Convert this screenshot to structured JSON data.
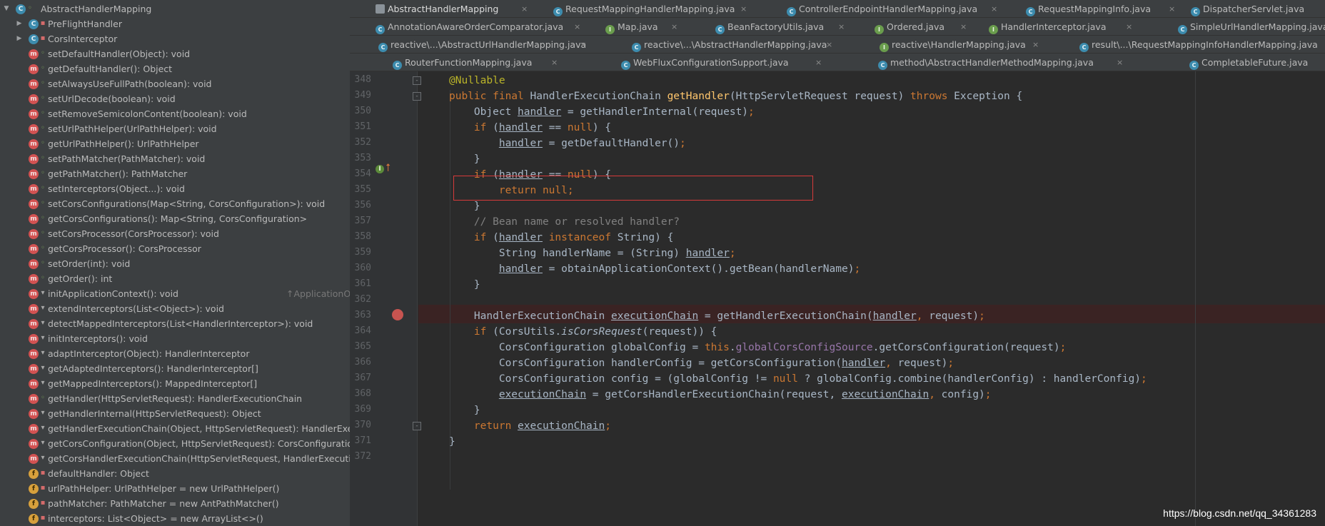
{
  "structure": {
    "root": {
      "label": "AbstractHandlerMapping",
      "icon": "class-icon"
    },
    "items": [
      {
        "label": "PreFlightHandler",
        "icon": "class-icon",
        "kind": "c",
        "access": "closed",
        "expandable": true
      },
      {
        "label": "CorsInterceptor",
        "icon": "class-icon",
        "kind": "c",
        "access": "closed",
        "expandable": true
      },
      {
        "label": "setDefaultHandler(Object): void",
        "kind": "m",
        "access": "open"
      },
      {
        "label": "getDefaultHandler(): Object",
        "kind": "m",
        "access": "open"
      },
      {
        "label": "setAlwaysUseFullPath(boolean): void",
        "kind": "m",
        "access": "open"
      },
      {
        "label": "setUrlDecode(boolean): void",
        "kind": "m",
        "access": "open"
      },
      {
        "label": "setRemoveSemicolonContent(boolean): void",
        "kind": "m",
        "access": "open"
      },
      {
        "label": "setUrlPathHelper(UrlPathHelper): void",
        "kind": "m",
        "access": "open"
      },
      {
        "label": "getUrlPathHelper(): UrlPathHelper",
        "kind": "m",
        "access": "open"
      },
      {
        "label": "setPathMatcher(PathMatcher): void",
        "kind": "m",
        "access": "open"
      },
      {
        "label": "getPathMatcher(): PathMatcher",
        "kind": "m",
        "access": "open"
      },
      {
        "label": "setInterceptors(Object...): void",
        "kind": "m",
        "access": "open"
      },
      {
        "label": "setCorsConfigurations(Map<String, CorsConfiguration>): void",
        "kind": "m",
        "access": "open"
      },
      {
        "label": "getCorsConfigurations(): Map<String, CorsConfiguration>",
        "kind": "m",
        "access": "open"
      },
      {
        "label": "setCorsProcessor(CorsProcessor): void",
        "kind": "m",
        "access": "open"
      },
      {
        "label": "getCorsProcessor(): CorsProcessor",
        "kind": "m",
        "access": "open"
      },
      {
        "label": "setOrder(int): void",
        "kind": "m",
        "access": "open"
      },
      {
        "label": "getOrder(): int",
        "kind": "m",
        "access": "open"
      },
      {
        "label": "initApplicationContext(): void",
        "hint": "↑ApplicationObjectSupport",
        "kind": "m",
        "access": "prot"
      },
      {
        "label": "extendInterceptors(List<Object>): void",
        "kind": "m",
        "access": "prot"
      },
      {
        "label": "detectMappedInterceptors(List<HandlerInterceptor>): void",
        "kind": "m",
        "access": "prot"
      },
      {
        "label": "initInterceptors(): void",
        "kind": "m",
        "access": "prot"
      },
      {
        "label": "adaptInterceptor(Object): HandlerInterceptor",
        "kind": "m",
        "access": "prot"
      },
      {
        "label": "getAdaptedInterceptors(): HandlerInterceptor[]",
        "kind": "m",
        "access": "prot"
      },
      {
        "label": "getMappedInterceptors(): MappedInterceptor[]",
        "kind": "m",
        "access": "prot"
      },
      {
        "label": "getHandler(HttpServletRequest): HandlerExecutionChain",
        "kind": "m",
        "access": "open"
      },
      {
        "label": "getHandlerInternal(HttpServletRequest): Object",
        "kind": "m",
        "access": "prot"
      },
      {
        "label": "getHandlerExecutionChain(Object, HttpServletRequest): HandlerExecuti",
        "kind": "m",
        "access": "prot"
      },
      {
        "label": "getCorsConfiguration(Object, HttpServletRequest): CorsConfiguration",
        "kind": "m",
        "access": "prot"
      },
      {
        "label": "getCorsHandlerExecutionChain(HttpServletRequest, HandlerExecutionCh",
        "kind": "m",
        "access": "prot"
      },
      {
        "label": "defaultHandler: Object",
        "kind": "f",
        "access": "closed"
      },
      {
        "label": "urlPathHelper: UrlPathHelper = new UrlPathHelper()",
        "kind": "f",
        "access": "closed"
      },
      {
        "label": "pathMatcher: PathMatcher = new AntPathMatcher()",
        "kind": "f",
        "access": "closed"
      },
      {
        "label": "interceptors: List<Object> = new ArrayList<>()",
        "kind": "f",
        "access": "closed"
      }
    ]
  },
  "tabs": {
    "row1": [
      "AbstractHandlerMapping",
      "RequestMappingHandlerMapping.java",
      "ControllerEndpointHandlerMapping.java",
      "RequestMappingInfo.java",
      "DispatcherServlet.java"
    ],
    "row2": [
      "AnnotationAwareOrderComparator.java",
      "Map.java",
      "BeanFactoryUtils.java",
      "Ordered.java",
      "HandlerInterceptor.java",
      "SimpleUrlHandlerMapping.java"
    ],
    "row3": [
      "reactive\\...\\AbstractUrlHandlerMapping.java",
      "reactive\\...\\AbstractHandlerMapping.java",
      "reactive\\HandlerMapping.java",
      "result\\...\\RequestMappingInfoHandlerMapping.java"
    ],
    "row4": [
      "RouterFunctionMapping.java",
      "WebFluxConfigurationSupport.java",
      "method\\AbstractHandlerMethodMapping.java",
      "CompletableFuture.java"
    ],
    "close_glyph": "×"
  },
  "editor": {
    "line_numbers": [
      "348",
      "349",
      "350",
      "351",
      "352",
      "353",
      "354",
      "355",
      "356",
      "357",
      "358",
      "359",
      "360",
      "361",
      "362",
      "363",
      "364",
      "365",
      "366",
      "367",
      "368",
      "369",
      "370",
      "371",
      "372"
    ],
    "tokens": {
      "l348_ann": "@Nullable",
      "l349_kw": "public final ",
      "l349_type": "HandlerExecutionChain ",
      "l349_name": "getHandler",
      "l349_params": "(HttpServletRequest request) ",
      "l349_throws": "throws ",
      "l349_rest": "Exception {",
      "l350_type": "Object ",
      "l350_var": "handler",
      "l350_rest": " = getHandlerInternal(request)",
      "semi": ";",
      "if": "if ",
      "open_paren": "(",
      "handler": "handler",
      "eq_null": " == ",
      "null": "null",
      "close_brace_open": ") {",
      "l352_rest": " = getDefaultHandler()",
      "close": "}",
      "return": "return ",
      "l357_comment": "// Bean name or resolved handler?",
      "instanceof": " instanceof ",
      "string_open": "String) {",
      "l359_decl": "String handlerName = (String) ",
      "l360_rest": " = obtainApplicationContext().getBean(handlerName)",
      "l363_type": "HandlerExecutionChain ",
      "executionChain": "executionChain",
      "l363_rest": " = getHandlerExecutionChain(",
      "comma": ", ",
      "request_close": "request)",
      "l364_pre": "(CorsUtils.",
      "l364_method": "isCorsRequest",
      "l364_rest": "(request)) {",
      "l365_decl": "CorsConfiguration globalConfig = ",
      "this": "this",
      "dot": ".",
      "l365_field": "globalCorsConfigSource",
      "l365_rest": ".getCorsConfiguration(request)",
      "l366_decl": "CorsConfiguration handlerConfig = getCorsConfiguration(",
      "l367_decl": "CorsConfiguration config = (globalConfig != ",
      "l367_rest": " ? globalConfig.",
      "l367_combine": "combine",
      "l367_tail": "(handlerConfig) : handlerConfig)",
      "l368_rest": " = getCorsHandlerExecutionChain(request, ",
      "l368_tail": "config)"
    }
  },
  "watermark": "https://blog.csdn.net/qq_34361283",
  "colors": {
    "keyword": "#cc7832",
    "method": "#ffc66d",
    "field": "#9876aa",
    "annotation": "#bbb529",
    "comment": "#808080",
    "highlight_box": "#d63a3a",
    "breakpoint": "#c75450"
  }
}
